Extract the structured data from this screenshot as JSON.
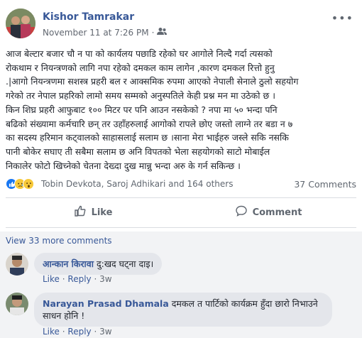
{
  "post": {
    "author": "Kishor Tamrakar",
    "timestamp": "November 11 at 7:26 PM",
    "body_lines": [
      "आज बेल्टार बजार चौ न पा को कार्यलय पछाडि रहेको घर आगोले निल्दै गर्दा त्यसको",
      "रोकथाम र नियन्त्रणको लागि नपा रहेको दमकल काम लागेन ,कारण दमकल रित्तो हुनु",
      ".|आगो नियन्त्रणमा सशस्त्र प्रहरी बल र आक्समिक रुपमा आएको नेपाली सेनाले ठुलो सहयोग",
      "गरेको तर नेपाल प्रहरिको लामो समय सम्मको अनुस्पतिले केही प्रश्न मन मा उठेको छ ।",
      "किन शिघ्र प्रहरी आफुबाट १०० मिटर पर पनि आउन नसकेको ? नपा मा ५० भन्दा पनि",
      "बढिको संख्यामा कर्मचारि छन् तर उहाँहरुलाई आगोको रापले छोए जस्तो लाग्ने तर बडा न ७",
      "का सदस्य हरिमान कट्वालको साहासलाई सलाम छ ।साना मेरा भाईहरु जस्ले सकि नसकि",
      "पानी बोकेर सघाए ती सबैमा सलाम छ अनि विपतको भेला सहयोगको साटो मोबाईल",
      "निकालेर फोटो खिच्नेको चेतना देख्दा दुख मान्नु भन्दा अरु के गर्न सकिन्छ ।"
    ],
    "reactions_text": "Tobin Devkota, Saroj Adhikari and 164 others",
    "comments_count": "37 Comments",
    "like_label": "Like",
    "comment_label": "Comment",
    "view_more": "View 33 more comments"
  },
  "comments": [
    {
      "name": "आन्कान किरावा",
      "text": "दु:खद घट्ना दाइ।",
      "like": "Like",
      "reply": "Reply",
      "time": "3w"
    },
    {
      "name": "Narayan Prasad Dhamala",
      "text_line1": "दमकल त पार्टिको कार्यक्रम हुँदा छारो निभाउने",
      "text_line2": "साधन होनि !",
      "like": "Like",
      "reply": "Reply",
      "time": "3w"
    }
  ],
  "icons": {
    "more": "more-horizontal-icon",
    "audience": "friends-icon",
    "like": "thumbs-up-icon",
    "comment": "speech-bubble-icon"
  },
  "colors": {
    "link": "#385898",
    "like_reaction": "#1877f2",
    "sad_reaction": "#f7c93a"
  }
}
